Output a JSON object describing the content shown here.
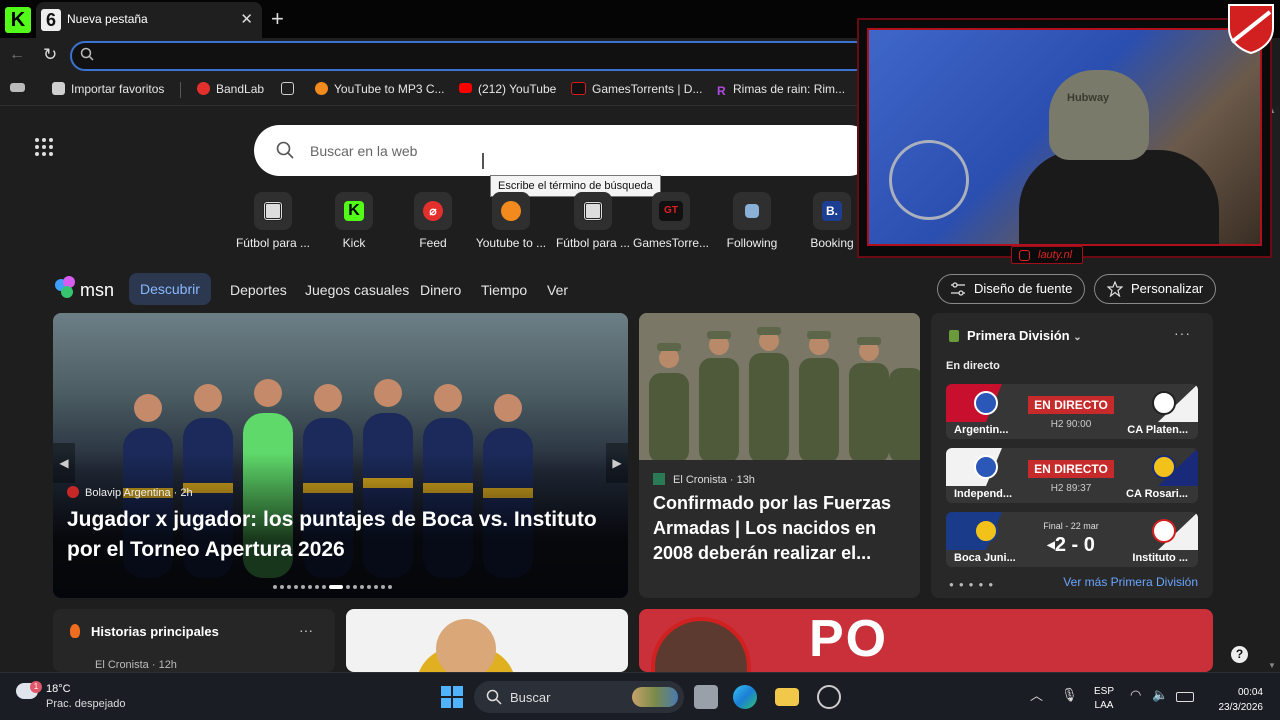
{
  "browser": {
    "tab_title": "Nueva pestaña",
    "tab_badge": "6",
    "close_glyph": "✕",
    "new_tab_glyph": "+",
    "address_value": ""
  },
  "favorites": [
    {
      "label": "Importar favoritos",
      "icon": "import-icon",
      "color": "#cfcfcf"
    },
    {
      "label": "BandLab",
      "icon": "bandlab-icon",
      "color": "#e4302c"
    },
    {
      "label": "",
      "icon": "collections-icon",
      "color": "#cfcfcf"
    },
    {
      "label": "YouTube to MP3 C...",
      "icon": "ytmp3-icon",
      "color": "#f28a1d"
    },
    {
      "label": "(212) YouTube",
      "icon": "youtube-icon",
      "color": "#ff0000"
    },
    {
      "label": "GamesTorrents | D...",
      "icon": "gt-icon",
      "color": "#d41c1c"
    },
    {
      "label": "Rimas de rain: Rim...",
      "icon": "r-icon",
      "color": "#b04ae0"
    }
  ],
  "search": {
    "placeholder": "Buscar en la web",
    "tooltip": "Escribe el término de búsqueda"
  },
  "quicklinks": [
    {
      "label": "Fútbol para ...",
      "glyph": "",
      "bg": "#ddd",
      "fg": "#111"
    },
    {
      "label": "Kick",
      "glyph": "K",
      "bg": "#53fc18",
      "fg": "#000"
    },
    {
      "label": "Feed",
      "glyph": "⌀",
      "bg": "#e4302c",
      "fg": "#fff"
    },
    {
      "label": "Youtube to ...",
      "glyph": "",
      "bg": "#f28a1d",
      "fg": "#fff"
    },
    {
      "label": "Fútbol para ...",
      "glyph": "",
      "bg": "#ddd",
      "fg": "#111"
    },
    {
      "label": "GamesTorre...",
      "glyph": "GT",
      "bg": "#111",
      "fg": "#e02020"
    },
    {
      "label": "Following",
      "glyph": "",
      "bg": "#8ab0d8",
      "fg": "#fff"
    },
    {
      "label": "Booking",
      "glyph": "B.",
      "bg": "#1c3f94",
      "fg": "#fff"
    }
  ],
  "msn": {
    "logo_text": "msn",
    "categories": [
      "Descubrir",
      "Deportes",
      "Juegos casuales",
      "Dinero",
      "Tiempo",
      "Ver"
    ],
    "font_button": "Diseño de fuente",
    "personalize_button": "Personalizar"
  },
  "hero": {
    "source": "Bolavip Argentina · 2h",
    "title": "Jugador x jugador: los puntajes de Boca vs. Instituto por el Torneo Apertura 2026",
    "slides": 16,
    "active_slide": 8
  },
  "news2": {
    "source": "El Cronista · 13h",
    "title": "Confirmado por las Fuerzas Armadas | Los nacidos en 2008 deberán realizar el..."
  },
  "league": {
    "title": "Primera División",
    "live_label": "En directo",
    "more_link": "Ver más Primera División",
    "matches": [
      {
        "home": "Argentin...",
        "away": "CA Platen...",
        "status": "EN DIRECTO",
        "time": "H2 90:00",
        "home_color": "#c8102e",
        "away_color": "#f2f2f2",
        "home_crest": "#2b57b8",
        "away_crest": "#fff"
      },
      {
        "home": "Independ...",
        "away": "CA Rosari...",
        "status": "EN DIRECTO",
        "time": "H2 89:37",
        "home_color": "#f2f2f2",
        "away_color": "#1a2a7a",
        "home_crest": "#2b57b8",
        "away_crest": "#f2c21a"
      },
      {
        "home": "Boca Juni...",
        "away": "Instituto ...",
        "status": "Final - 22 mar",
        "score": "2 - 0",
        "home_color": "#1a3a8a",
        "away_color": "#f2f2f2",
        "home_crest": "#f2c21a",
        "away_crest": "#d02020"
      }
    ]
  },
  "bottom": {
    "top_stories": "Historias principales",
    "top_stories_source": "El Cronista · 12h",
    "banner_text": "PO"
  },
  "webcam": {
    "handle": "lauty.nl",
    "cap_text": "Hubway"
  },
  "taskbar": {
    "temperature": "18°C",
    "condition": "Prac. despejado",
    "weather_badge": "1",
    "search_label": "Buscar",
    "lang_top": "ESP",
    "lang_bottom": "LAA",
    "time": "00:04",
    "date": "23/3/2026"
  }
}
